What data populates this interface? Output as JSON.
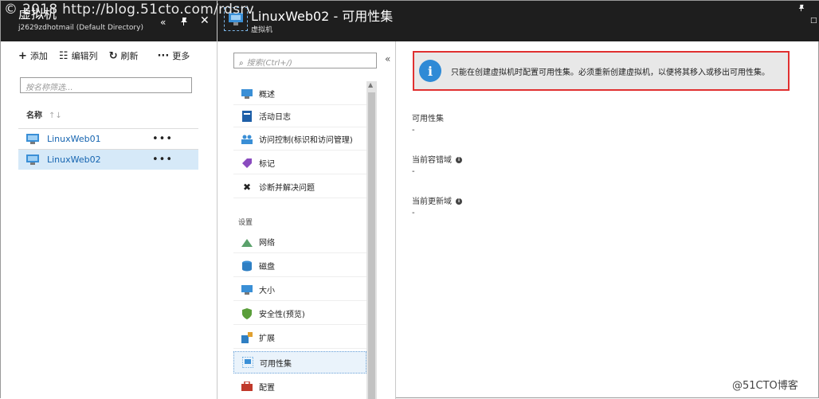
{
  "watermark": "© 2018 http://blog.51cto.com/rdsrv",
  "watermark_corner": "@51CTO博客",
  "left_blade": {
    "title": "虚拟机",
    "subtitle": "j2629zdhotmail (Default Directory)",
    "toolbar": {
      "add": "添加",
      "edit_columns": "编辑列",
      "refresh": "刷新",
      "more": "更多"
    },
    "filter_placeholder": "按名称筛选...",
    "column_name": "名称",
    "vms": [
      {
        "name": "LinuxWeb01",
        "dots": "•••"
      },
      {
        "name": "LinuxWeb02",
        "dots": "•••"
      }
    ]
  },
  "blade2": {
    "title": "LinuxWeb02 - 可用性集",
    "subtitle": "虚拟机",
    "search_placeholder": "搜索(Ctrl+/)",
    "menu": {
      "overview": "概述",
      "activity_log": "活动日志",
      "access_control": "访问控制(标识和访问管理)",
      "tags": "标记",
      "diagnose": "诊断并解决问题",
      "section_settings": "设置",
      "networking": "网络",
      "disks": "磁盘",
      "size": "大小",
      "security": "安全性(预览)",
      "extensions": "扩展",
      "availability_set": "可用性集",
      "configuration": "配置"
    }
  },
  "content": {
    "notice": "只能在创建虚拟机时配置可用性集。必须重新创建虚拟机，以便将其移入或移出可用性集。",
    "props": [
      {
        "label": "可用性集",
        "value": "-"
      },
      {
        "label": "当前容错域",
        "value": "-"
      },
      {
        "label": "当前更新域",
        "value": "-"
      }
    ]
  },
  "colors": {
    "accent": "#1564b0",
    "header": "#1e1e1e",
    "highlight": "#e03030"
  }
}
